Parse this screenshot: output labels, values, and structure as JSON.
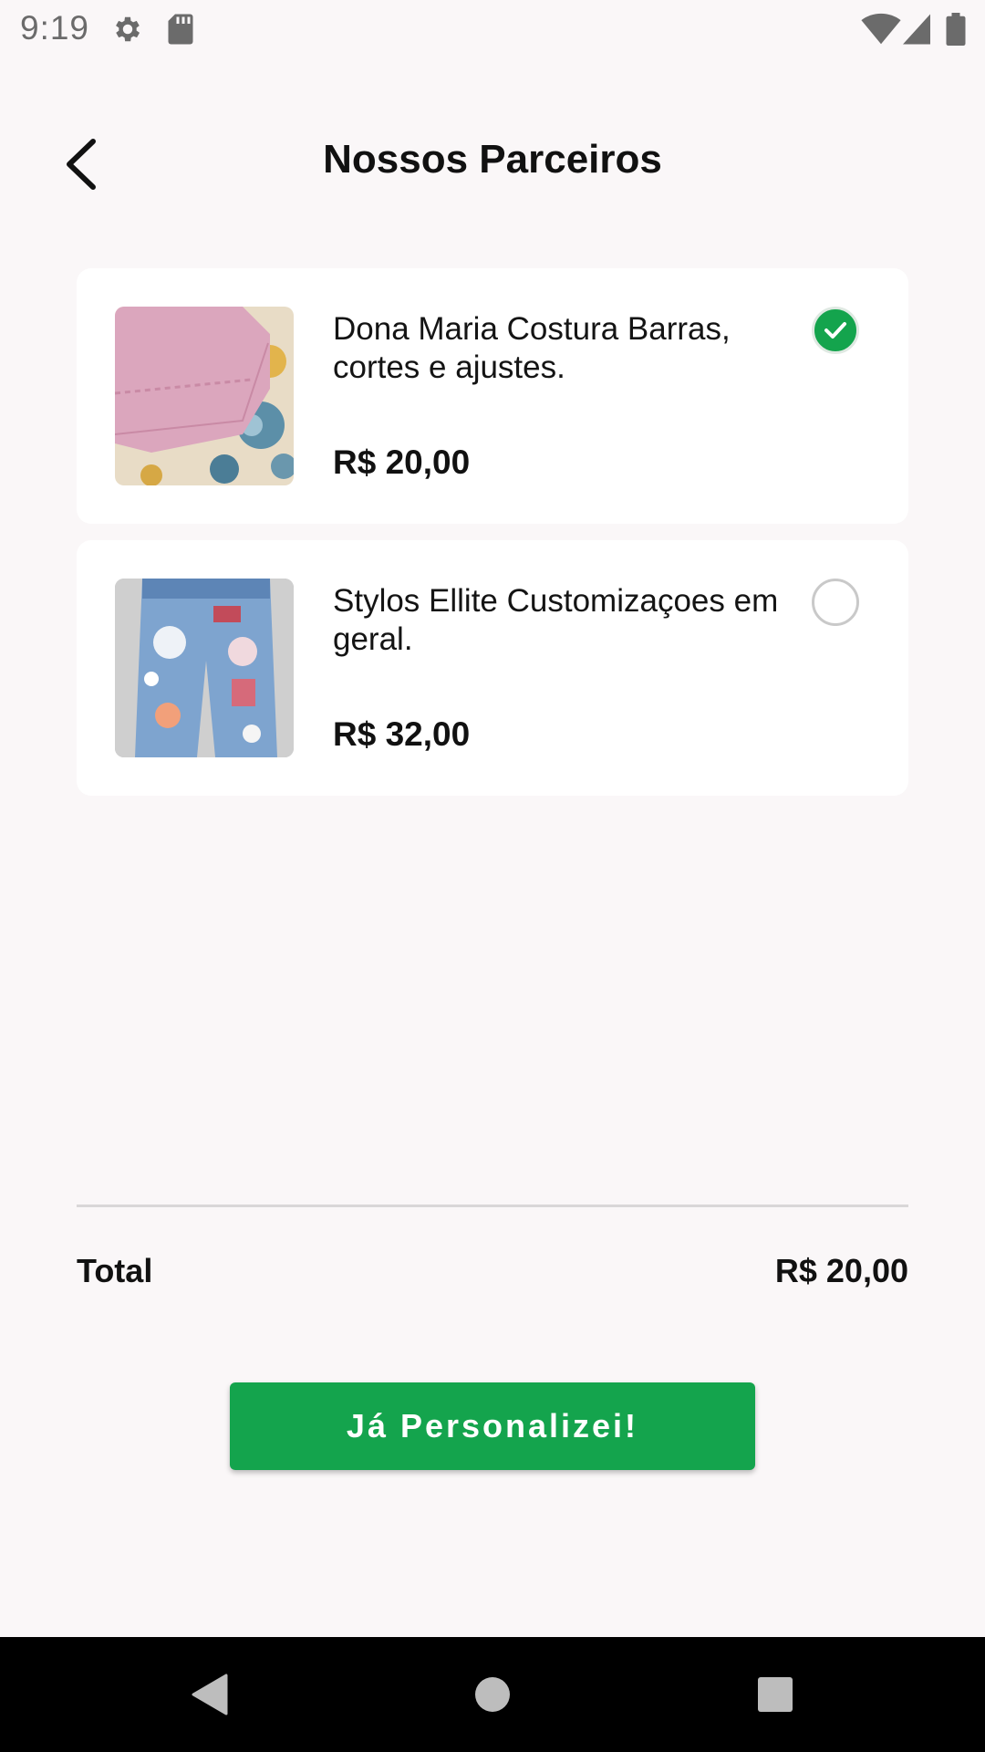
{
  "status_bar": {
    "time": "9:19",
    "icons": [
      "gear-icon",
      "sd-card-icon",
      "wifi-icon",
      "cell-signal-icon",
      "battery-icon"
    ]
  },
  "header": {
    "title": "Nossos Parceiros",
    "back_icon": "chevron-left-icon"
  },
  "partners": [
    {
      "name": "Dona Maria Costura Barras, cortes e ajustes.",
      "price": "R$ 20,00",
      "selected": true,
      "image": "pink fabric hem photo"
    },
    {
      "name": "Stylos Ellite Customizaçoes em geral.",
      "price": "R$ 32,00",
      "selected": false,
      "image": "customized jeans photo"
    }
  ],
  "summary": {
    "total_label": "Total",
    "total_value": "R$ 20,00"
  },
  "action": {
    "confirm_label": "Já Personalizei!"
  },
  "nav": {
    "icons": [
      "back-triangle-icon",
      "home-circle-icon",
      "recents-square-icon"
    ]
  },
  "colors": {
    "accent": "#14a44d",
    "background": "#faf7f8",
    "card": "#ffffff",
    "nav_bar": "#000000"
  }
}
